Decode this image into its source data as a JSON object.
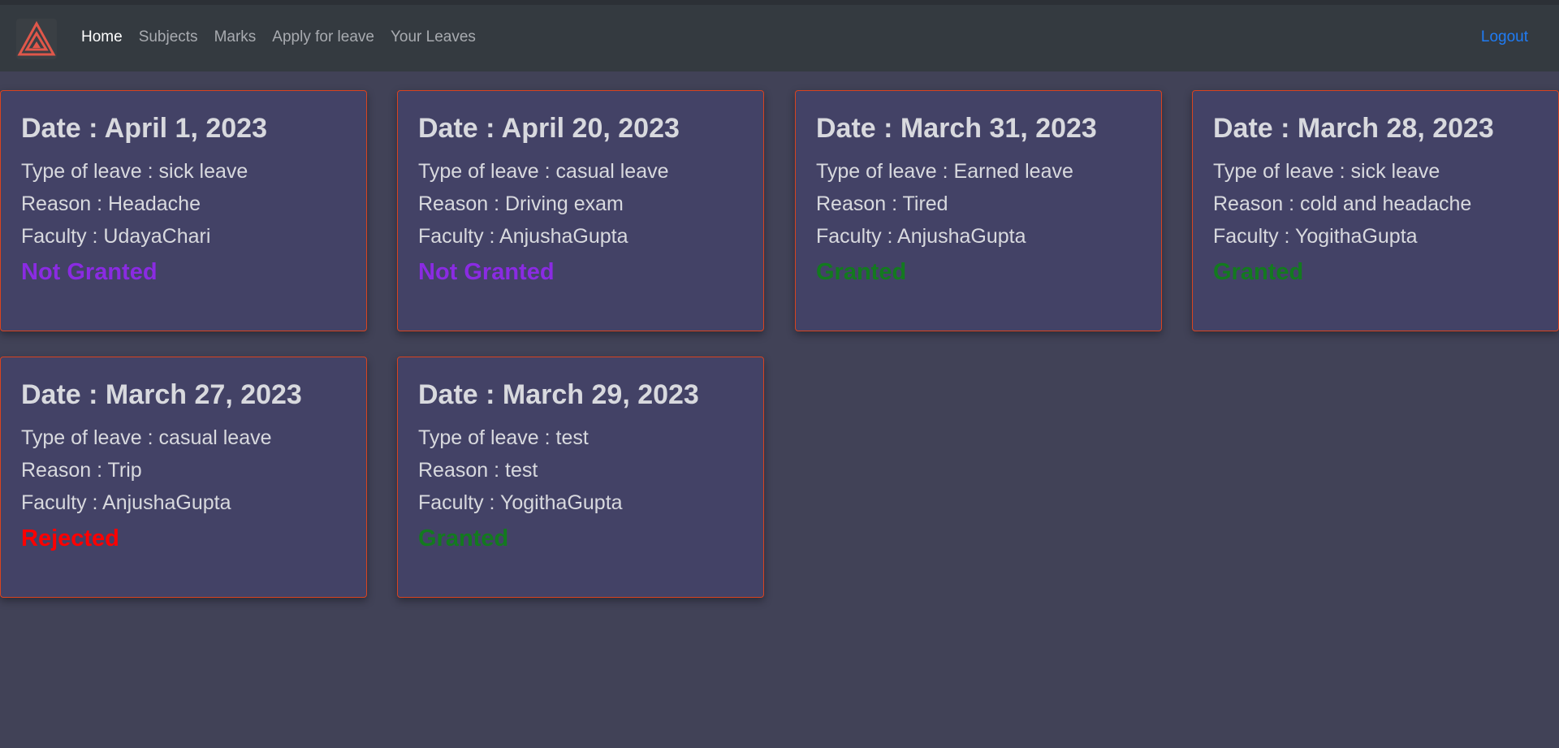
{
  "navbar": {
    "brand_icon": "triangle-logo-icon",
    "brand_color": "#e0574a",
    "links": [
      {
        "label": "Home",
        "active": true
      },
      {
        "label": "Subjects",
        "active": false
      },
      {
        "label": "Marks",
        "active": false
      },
      {
        "label": "Apply for leave",
        "active": false
      },
      {
        "label": "Your Leaves",
        "active": false
      }
    ],
    "logout_label": "Logout"
  },
  "leaves": [
    {
      "date": "Date : April 1, 2023",
      "type": "Type of leave : sick leave",
      "reason": "Reason : Headache",
      "faculty": "Faculty : UdayaChari",
      "status": "Not Granted"
    },
    {
      "date": "Date : April 20, 2023",
      "type": "Type of leave : casual leave",
      "reason": "Reason : Driving exam",
      "faculty": "Faculty : AnjushaGupta",
      "status": "Not Granted"
    },
    {
      "date": "Date : March 31, 2023",
      "type": "Type of leave : Earned leave",
      "reason": "Reason : Tired",
      "faculty": "Faculty : AnjushaGupta",
      "status": "Granted"
    },
    {
      "date": "Date : March 28, 2023",
      "type": "Type of leave : sick leave",
      "reason": "Reason : cold and headache",
      "faculty": "Faculty : YogithaGupta",
      "status": "Granted"
    },
    {
      "date": "Date : March 27, 2023",
      "type": "Type of leave : casual leave",
      "reason": "Reason : Trip",
      "faculty": "Faculty : AnjushaGupta",
      "status": "Rejected"
    },
    {
      "date": "Date : March 29, 2023",
      "type": "Type of leave : test",
      "reason": "Reason : test",
      "faculty": "Faculty : YogithaGupta",
      "status": "Granted"
    }
  ],
  "colors": {
    "background": "#414257",
    "navbar": "#343a40",
    "card": "#434266",
    "card_border": "#d9431f",
    "not_granted": "#8a2be2",
    "granted": "#137a1f",
    "rejected": "#ff0000",
    "link": "#1f7cf5"
  }
}
